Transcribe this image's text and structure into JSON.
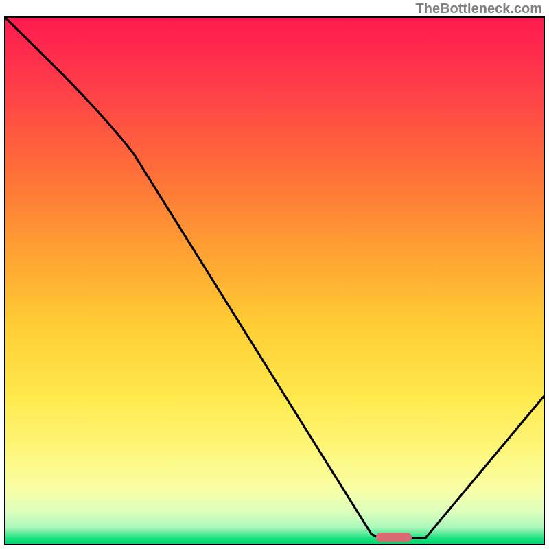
{
  "watermark": "TheBottleneck.com",
  "chart_data": {
    "type": "line",
    "title": "",
    "xlabel": "",
    "ylabel": "",
    "xlim": [
      0,
      100
    ],
    "ylim": [
      0,
      100
    ],
    "x": [
      0,
      10,
      24,
      68,
      74,
      78,
      100
    ],
    "values": [
      100,
      90,
      75,
      2,
      1,
      1,
      28
    ],
    "marker": {
      "x_center": 72,
      "y": 0.5,
      "color": "#db6b72"
    },
    "background_gradient": {
      "top": "#ff1a4f",
      "mid_upper": "#ff9933",
      "mid_lower": "#ffe94d",
      "bottom": "#00d56e"
    },
    "note": "Axis values are normalized 0–100 fractions of plot area; no numeric tick labels are shown in the image."
  }
}
